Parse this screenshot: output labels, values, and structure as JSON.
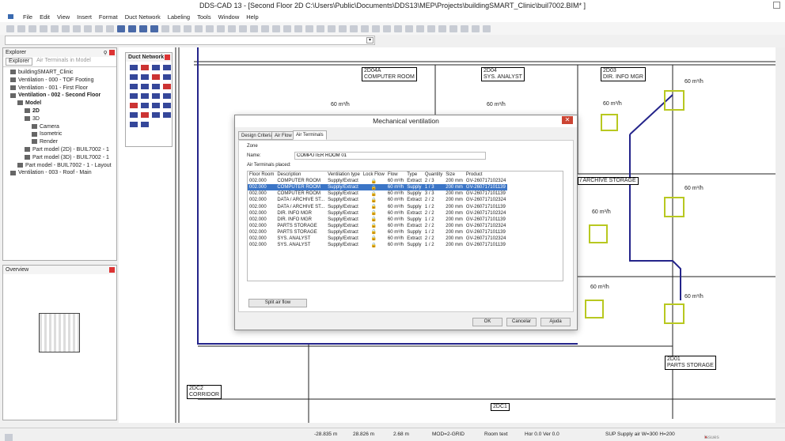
{
  "window": {
    "title": "DDS-CAD 13 - [Second Floor  2D  C:\\Users\\Public\\Documents\\DDS13\\MEP\\Projects\\buildingSMART_Clinic\\buil7002.BIM* ]"
  },
  "menu": [
    "File",
    "Edit",
    "View",
    "Insert",
    "Format",
    "Duct Network",
    "Labeling",
    "Tools",
    "Window",
    "Help"
  ],
  "explorer": {
    "title": "Explorer",
    "pin": "ϙ",
    "tabs": [
      "Explorer",
      "Air Terminals in Model"
    ],
    "tree": [
      {
        "label": "buildingSMART_Clinic",
        "level": 1,
        "bold": false
      },
      {
        "label": "Ventilation - 000 - TOF Footing",
        "level": 1,
        "bold": false
      },
      {
        "label": "Ventilation - 001 - First Floor",
        "level": 1,
        "bold": false
      },
      {
        "label": "Ventilation - 002 - Second Floor",
        "level": 1,
        "bold": true
      },
      {
        "label": "Model",
        "level": 2,
        "bold": true
      },
      {
        "label": "2D",
        "level": 3,
        "bold": true
      },
      {
        "label": "3D",
        "level": 3,
        "bold": false
      },
      {
        "label": "Camera",
        "level": 4,
        "bold": false
      },
      {
        "label": "Isometric",
        "level": 4,
        "bold": false
      },
      {
        "label": "Render",
        "level": 4,
        "bold": false
      },
      {
        "label": "Part model (2D) - BUIL7002 - 1",
        "level": 3,
        "bold": false
      },
      {
        "label": "Part model (3D) - BUIL7002 - 1",
        "level": 3,
        "bold": false
      },
      {
        "label": "Part model - BUIL7002 - 1 - Layout",
        "level": 2,
        "bold": false
      },
      {
        "label": "Ventilation - 003 - Roof - Main",
        "level": 1,
        "bold": false
      }
    ]
  },
  "overview": {
    "title": "Overview"
  },
  "duct_network": {
    "title": "Duct Network"
  },
  "drawing": {
    "rooms": [
      {
        "code": "2D04A",
        "name": "COMPUTER ROOM"
      },
      {
        "code": "2D04",
        "name": "SYS. ANALYST"
      },
      {
        "code": "2D03",
        "name": "DIR. INFO MGR"
      },
      {
        "code": "",
        "name": "/ ARCHIVE STORAGE"
      },
      {
        "code": "2D01",
        "name": "PARTS STORAGE"
      },
      {
        "code": "2DC2",
        "name": "CORRIDOR"
      },
      {
        "code": "2DC1",
        "name": ""
      }
    ],
    "flow_label": "60 m³/h"
  },
  "dialog": {
    "title": "Mechanical ventilation",
    "tabs": [
      "Design Criteria",
      "Air Flow",
      "Air Terminals"
    ],
    "active_tab": 2,
    "zone_label": "Zone",
    "name_label": "Name:",
    "name_value": "COMPUTER ROOM 01",
    "placed_label": "Air Terminals placed:",
    "columns": [
      "Floor Room",
      "Description",
      "Ventilation type",
      "Lock Flow",
      "Flow",
      "Type",
      "Quantity",
      "Size",
      "Product"
    ],
    "rows": [
      [
        "002.000",
        "COMPUTER ROOM",
        "Supply/Extract",
        "🔒",
        "60 m³/h",
        "Extract",
        "2 / 3",
        "200 mm",
        "GV-260717102324"
      ],
      [
        "002.000",
        "COMPUTER ROOM",
        "Supply/Extract",
        "🔒",
        "60 m³/h",
        "Supply",
        "1 / 3",
        "200 mm",
        "GV-260717101139"
      ],
      [
        "002.000",
        "COMPUTER ROOM",
        "Supply/Extract",
        "🔒",
        "60 m³/h",
        "Supply",
        "3 / 3",
        "200 mm",
        "GV-260717101139"
      ],
      [
        "002.000",
        "DATA / ARCHIVE ST...",
        "Supply/Extract",
        "🔒",
        "60 m³/h",
        "Extract",
        "2 / 2",
        "200 mm",
        "GV-260717102324"
      ],
      [
        "002.000",
        "DATA / ARCHIVE ST...",
        "Supply/Extract",
        "🔒",
        "60 m³/h",
        "Supply",
        "1 / 2",
        "200 mm",
        "GV-260717101139"
      ],
      [
        "002.000",
        "DIR. INFO MGR",
        "Supply/Extract",
        "🔒",
        "60 m³/h",
        "Extract",
        "2 / 2",
        "200 mm",
        "GV-260717102324"
      ],
      [
        "002.000",
        "DIR. INFO MGR",
        "Supply/Extract",
        "🔒",
        "60 m³/h",
        "Supply",
        "1 / 2",
        "200 mm",
        "GV-260717101139"
      ],
      [
        "002.000",
        "PARTS STORAGE",
        "Supply/Extract",
        "🔒",
        "60 m³/h",
        "Extract",
        "2 / 2",
        "200 mm",
        "GV-260717102324"
      ],
      [
        "002.000",
        "PARTS STORAGE",
        "Supply/Extract",
        "🔒",
        "60 m³/h",
        "Supply",
        "1 / 2",
        "200 mm",
        "GV-260717101139"
      ],
      [
        "002.000",
        "SYS. ANALYST",
        "Supply/Extract",
        "🔒",
        "60 m³/h",
        "Extract",
        "2 / 2",
        "200 mm",
        "GV-260717102324"
      ],
      [
        "002.000",
        "SYS. ANALYST",
        "Supply/Extract",
        "🔒",
        "60 m³/h",
        "Supply",
        "1 / 2",
        "200 mm",
        "GV-260717101139"
      ]
    ],
    "selected_row": 1,
    "split_button": "Split air flow",
    "ok": "OK",
    "cancel": "Cancelar",
    "help": "Ajuda"
  },
  "status": {
    "x": "-28.835 m",
    "y": "28.826 m",
    "z": "2.68 m",
    "mode": "MOD=2-GRID",
    "snap": "Room text",
    "angle": "Hor  0.0 Ver  0.0",
    "layer": "SUP Supply air W=300 H=200",
    "issues": "Issues"
  }
}
